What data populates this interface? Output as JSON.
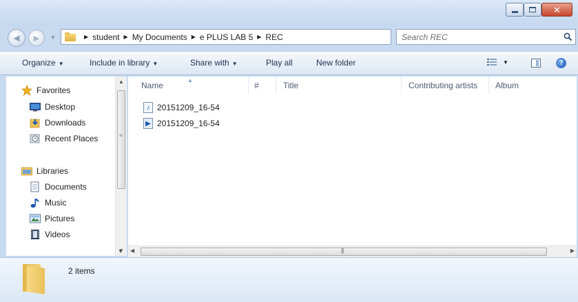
{
  "window": {
    "controls": {
      "minimize": "minimize-icon",
      "maximize": "maximize-icon",
      "close": "close-icon"
    }
  },
  "nav": {
    "back": "back-arrow-icon",
    "forward": "forward-arrow-icon"
  },
  "address": {
    "breadcrumbs": [
      "student",
      "My Documents",
      "e PLUS LAB 5",
      "REC"
    ]
  },
  "search": {
    "placeholder": "Search REC"
  },
  "toolbar": {
    "organize": "Organize",
    "include_in_library": "Include in library",
    "share_with": "Share with",
    "play_all": "Play all",
    "new_folder": "New folder"
  },
  "sidebar": {
    "favorites": {
      "label": "Favorites",
      "items": [
        {
          "label": "Desktop",
          "icon": "desktop-icon"
        },
        {
          "label": "Downloads",
          "icon": "downloads-icon"
        },
        {
          "label": "Recent Places",
          "icon": "recent-places-icon"
        }
      ]
    },
    "libraries": {
      "label": "Libraries",
      "items": [
        {
          "label": "Documents",
          "icon": "documents-icon"
        },
        {
          "label": "Music",
          "icon": "music-icon"
        },
        {
          "label": "Pictures",
          "icon": "pictures-icon"
        },
        {
          "label": "Videos",
          "icon": "videos-icon"
        }
      ]
    }
  },
  "columns": [
    "Name",
    "#",
    "Title",
    "Contributing artists",
    "Album"
  ],
  "files": [
    {
      "name": "20151209_16-54",
      "icon": "audio-file-icon"
    },
    {
      "name": "20151209_16-54",
      "icon": "media-file-icon"
    }
  ],
  "status": {
    "item_count": "2 items"
  },
  "colors": {
    "accent": "#3a6fb3",
    "frame": "#c8daf0",
    "favorites_star": "#f2b31e"
  }
}
